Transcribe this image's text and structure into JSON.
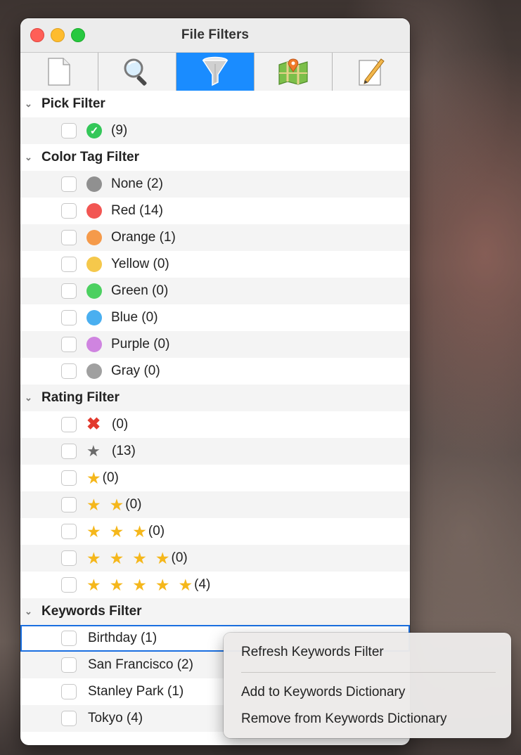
{
  "window": {
    "title": "File Filters"
  },
  "toolbar": {
    "tabs": [
      {
        "icon": "document-icon"
      },
      {
        "icon": "magnifier-icon"
      },
      {
        "icon": "funnel-icon",
        "active": true
      },
      {
        "icon": "map-icon"
      },
      {
        "icon": "notepad-pencil-icon"
      }
    ]
  },
  "sections": {
    "pick": {
      "title": "Pick Filter",
      "items": [
        {
          "label": "(9)"
        }
      ]
    },
    "color": {
      "title": "Color Tag Filter",
      "items": [
        {
          "label": "None (2)",
          "color": "#909090"
        },
        {
          "label": "Red (14)",
          "color": "#f25653"
        },
        {
          "label": "Orange (1)",
          "color": "#f59a4a"
        },
        {
          "label": "Yellow (0)",
          "color": "#f5c84b"
        },
        {
          "label": "Green (0)",
          "color": "#4cd060"
        },
        {
          "label": "Blue (0)",
          "color": "#4aaff0"
        },
        {
          "label": "Purple (0)",
          "color": "#cf84e0"
        },
        {
          "label": "Gray (0)",
          "color": "#a0a0a0"
        }
      ]
    },
    "rating": {
      "title": "Rating Filter",
      "items": [
        {
          "label": "(0)",
          "kind": "rejected"
        },
        {
          "label": "(13)",
          "kind": "unrated"
        },
        {
          "label": "(0)",
          "stars": 1
        },
        {
          "label": "(0)",
          "stars": 2
        },
        {
          "label": "(0)",
          "stars": 3
        },
        {
          "label": "(0)",
          "stars": 4
        },
        {
          "label": "(4)",
          "stars": 5
        }
      ]
    },
    "keywords": {
      "title": "Keywords Filter",
      "items": [
        {
          "label": "Birthday (1)"
        },
        {
          "label": "San Francisco (2)"
        },
        {
          "label": "Stanley Park (1)"
        },
        {
          "label": "Tokyo (4)"
        }
      ]
    }
  },
  "context_menu": {
    "items": [
      {
        "label": "Refresh Keywords Filter"
      },
      {
        "label": "Add to Keywords Dictionary"
      },
      {
        "label": "Remove from Keywords Dictionary"
      }
    ]
  }
}
